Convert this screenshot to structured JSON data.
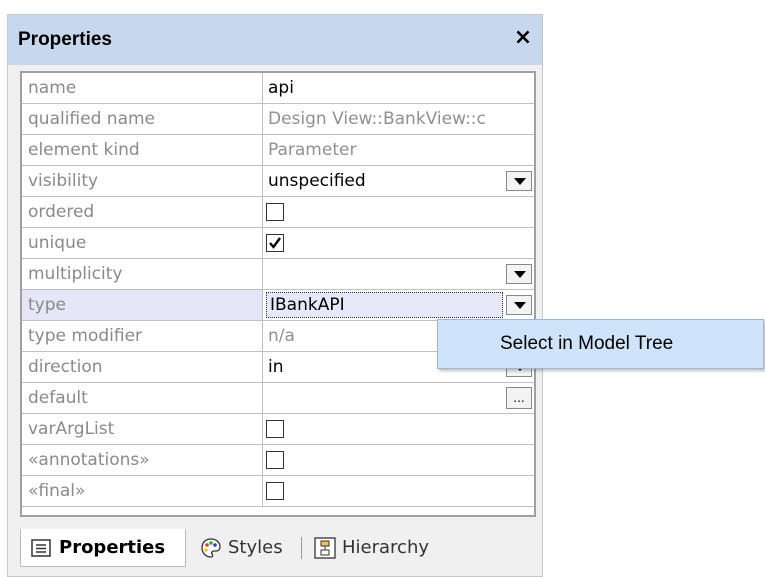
{
  "panel": {
    "title": "Properties",
    "close_label": "×"
  },
  "rows": {
    "name": {
      "label": "name",
      "value": "api"
    },
    "qualified_name": {
      "label": "qualified name",
      "value": "Design View::BankView::c"
    },
    "element_kind": {
      "label": "element kind",
      "value": "Parameter"
    },
    "visibility": {
      "label": "visibility",
      "value": "unspecified"
    },
    "ordered": {
      "label": "ordered",
      "checked": false
    },
    "unique": {
      "label": "unique",
      "checked": true
    },
    "multiplicity": {
      "label": "multiplicity",
      "value": ""
    },
    "type": {
      "label": "type",
      "value": "IBankAPI"
    },
    "type_modifier": {
      "label": "type modifier",
      "value": "n/a"
    },
    "direction": {
      "label": "direction",
      "value": "in"
    },
    "default": {
      "label": "default",
      "value": "",
      "button": "..."
    },
    "varArgList": {
      "label": "varArgList",
      "checked": false
    },
    "annotations": {
      "label": "«annotations»",
      "checked": false
    },
    "final": {
      "label": "«final»",
      "checked": false
    }
  },
  "context_menu": {
    "item": "Select in Model Tree"
  },
  "tabs": {
    "properties": "Properties",
    "styles": "Styles",
    "hierarchy": "Hierarchy"
  },
  "colors": {
    "titlebar": "#c7d8ee",
    "context_menu": "#cfe3fb",
    "selected_row": "#e6e6f7"
  }
}
